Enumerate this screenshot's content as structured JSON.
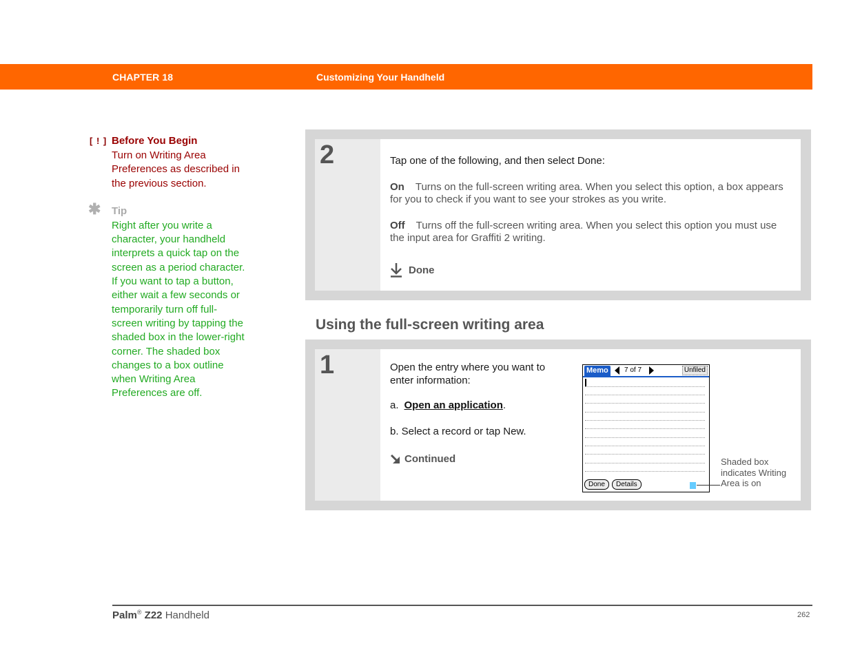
{
  "header": {
    "chapter": "CHAPTER 18",
    "title": "Customizing Your Handheld",
    "color": "#ff6600"
  },
  "sidebar": {
    "before_you_begin": {
      "icon": "[ ! ]",
      "title": "Before You Begin",
      "text": "Turn on Writing Area Preferences as described in the previous section."
    },
    "tip": {
      "icon": "asterisk-icon",
      "title": "Tip",
      "text": "Right after you write a character, your handheld interprets a quick tap on the screen as a period character. If you want to tap a button, either wait a few seconds or temporarily turn off full-screen writing by tapping the shaded box in the lower-right corner. The shaded box changes to a box outline when Writing Area Preferences are off."
    }
  },
  "step2": {
    "number": "2",
    "lead": "Tap one of the following, and then select Done:",
    "options": [
      {
        "key": "On",
        "text": "Turns on the full-screen writing area. When you select this option, a box appears for you to check if you want to see your strokes as you write."
      },
      {
        "key": "Off",
        "text": "Turns off the full-screen writing area. When you select this option you must use the input area for Graffiti 2 writing."
      }
    ],
    "done_label": "Done"
  },
  "section_title": "Using the full-screen writing area",
  "step1": {
    "number": "1",
    "lead": "Open the entry where you want to enter information:",
    "a_prefix": "a.",
    "a_link": "Open an application",
    "a_suffix": ".",
    "b_text": "b.  Select a record or tap New.",
    "continued_label": "Continued"
  },
  "palm_screen": {
    "app": "Memo",
    "count": "7 of 7",
    "category": "Unfiled",
    "buttons": [
      "Done",
      "Details"
    ],
    "shade_color": "#66ccff"
  },
  "callout": "Shaded box indicates Writing Area is on",
  "footer": {
    "brand": "Palm",
    "reg": "®",
    "model": "Z22",
    "product": "Handheld",
    "page": "262"
  }
}
